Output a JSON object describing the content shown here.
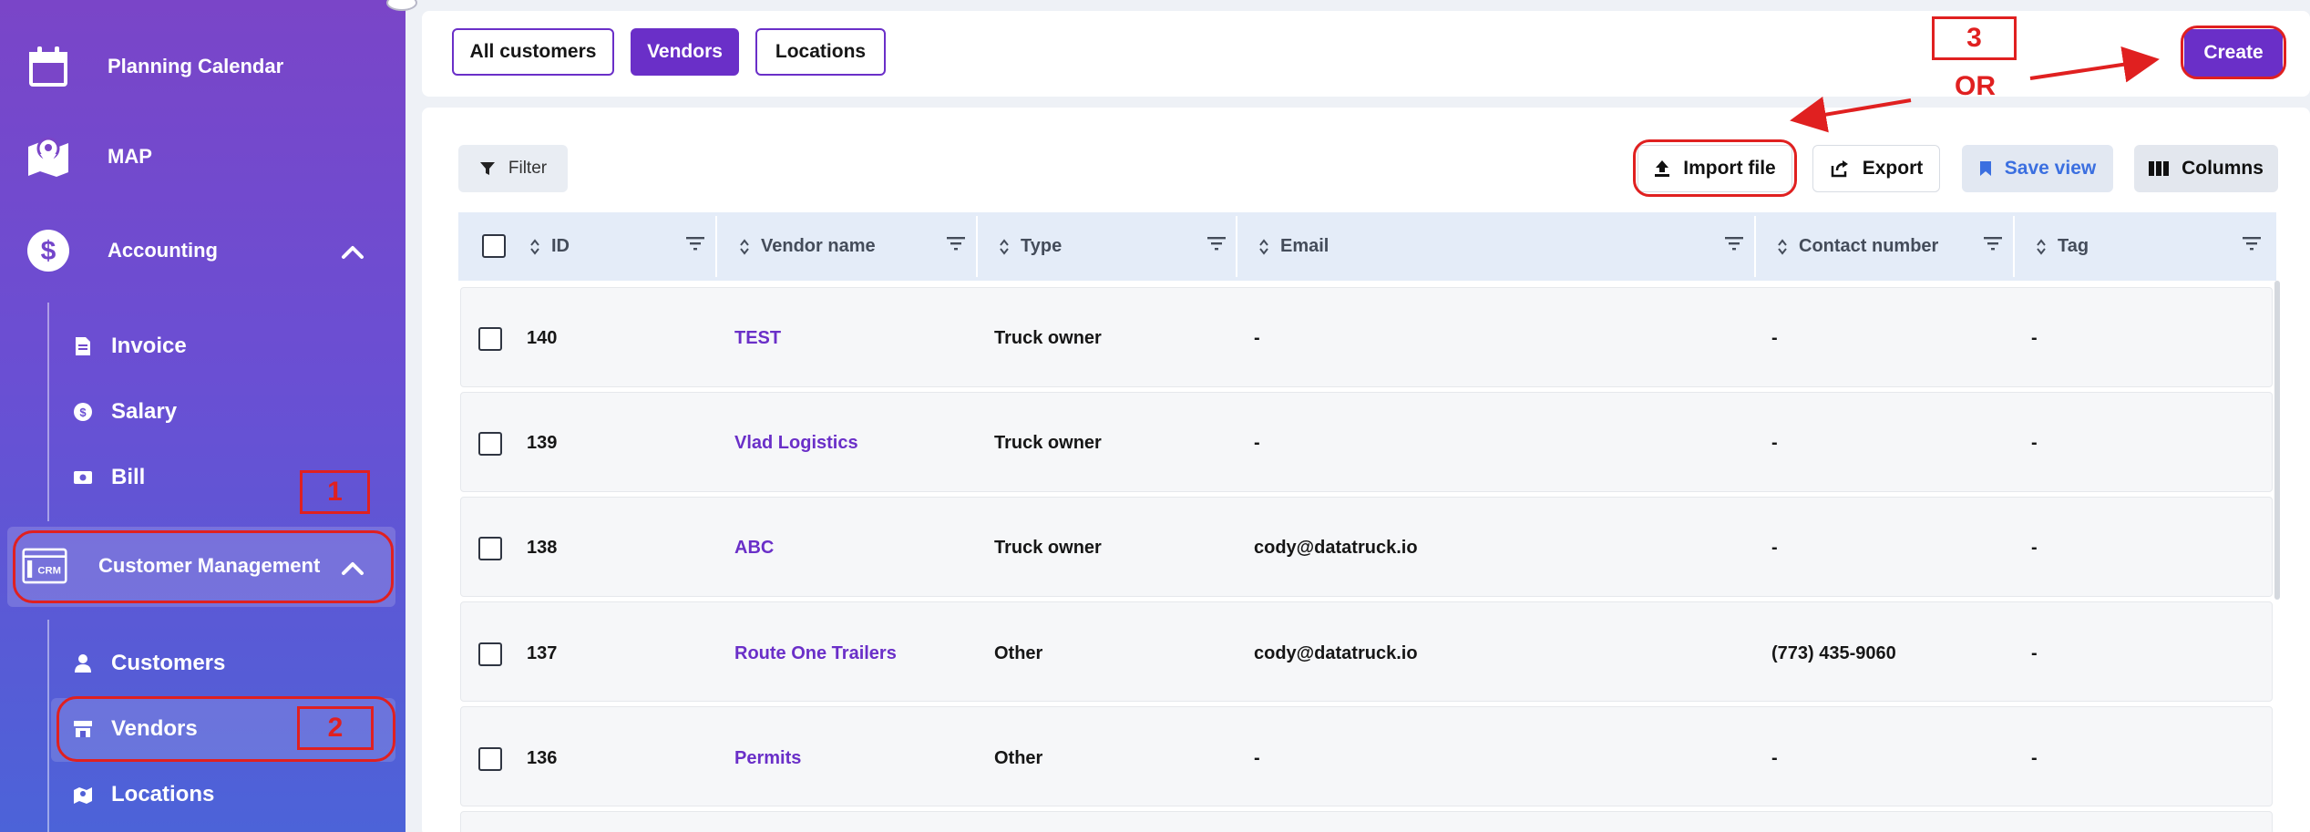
{
  "sidebar": {
    "items": [
      {
        "label": "Planning Calendar",
        "icon": "calendar-icon"
      },
      {
        "label": "MAP",
        "icon": "map-icon"
      },
      {
        "label": "Accounting",
        "icon": "dollar-icon"
      }
    ],
    "accounting_children": [
      {
        "label": "Invoice",
        "icon": "invoice-icon"
      },
      {
        "label": "Salary",
        "icon": "salary-icon"
      },
      {
        "label": "Bill",
        "icon": "bill-icon"
      }
    ],
    "crm": {
      "label": "Customer Management",
      "icon_text": "CRM"
    },
    "crm_children": [
      {
        "label": "Customers",
        "icon": "person-icon"
      },
      {
        "label": "Vendors",
        "icon": "store-icon"
      },
      {
        "label": "Locations",
        "icon": "location-icon"
      }
    ]
  },
  "tabs": [
    {
      "label": "All customers",
      "active": false
    },
    {
      "label": "Vendors",
      "active": true
    },
    {
      "label": "Locations",
      "active": false
    }
  ],
  "toolbar": {
    "create_label": "Create",
    "filter_label": "Filter",
    "import_label": "Import file",
    "export_label": "Export",
    "save_view_label": "Save view",
    "columns_label": "Columns"
  },
  "table": {
    "columns": [
      "ID",
      "Vendor name",
      "Type",
      "Email",
      "Contact number",
      "Tag"
    ],
    "rows": [
      {
        "id": "140",
        "name": "TEST",
        "type": "Truck owner",
        "email": "-",
        "contact": "-",
        "tag": "-"
      },
      {
        "id": "139",
        "name": "Vlad Logistics",
        "type": "Truck owner",
        "email": "-",
        "contact": "-",
        "tag": "-"
      },
      {
        "id": "138",
        "name": "ABC",
        "type": "Truck owner",
        "email": "cody@datatruck.io",
        "contact": "-",
        "tag": "-"
      },
      {
        "id": "137",
        "name": "Route One Trailers",
        "type": "Other",
        "email": "cody@datatruck.io",
        "contact": "(773) 435-9060",
        "tag": "-"
      },
      {
        "id": "136",
        "name": "Permits",
        "type": "Other",
        "email": "-",
        "contact": "-",
        "tag": "-"
      }
    ]
  },
  "annotations": {
    "step1": "1",
    "step2": "2",
    "step3": "3",
    "or_text": "OR",
    "color": "#e02020"
  },
  "colors": {
    "accent": "#6a2fc8",
    "sidebar_top": "#7a45c8",
    "sidebar_bottom": "#4c63d8",
    "header_bg": "#e4ecf8"
  }
}
